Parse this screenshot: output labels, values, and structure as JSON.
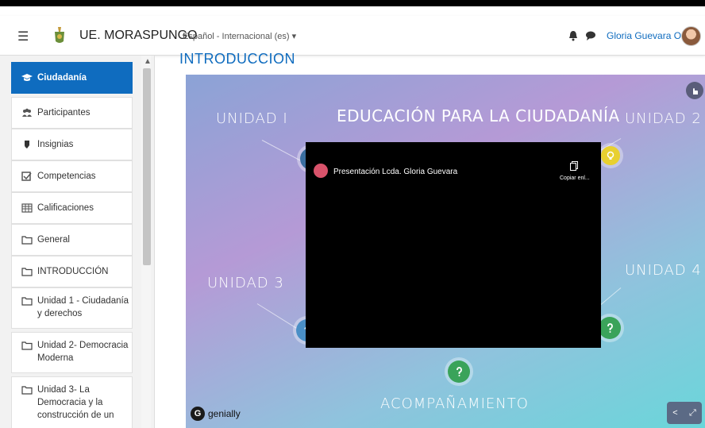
{
  "nav": {
    "menu_icon": "hamburger-icon",
    "site_name": "UE. MORASPUNGO",
    "language": "Español - Internacional (es) ▾",
    "user_name": "Gloria Guevara Ortiz"
  },
  "sidebar": {
    "items": [
      {
        "label": "Ciudadanía",
        "icon": "graduation-cap-icon"
      },
      {
        "label": "Participantes",
        "icon": "users-icon"
      },
      {
        "label": "Insignias",
        "icon": "shield-icon"
      },
      {
        "label": "Competencias",
        "icon": "checkbox-icon"
      },
      {
        "label": "Calificaciones",
        "icon": "table-icon"
      },
      {
        "label": "General",
        "icon": "folder-icon"
      },
      {
        "label": "INTRODUCCIÓN",
        "icon": "folder-icon"
      },
      {
        "label": "Unidad 1 - Ciudadanía y derechos",
        "icon": "folder-icon"
      },
      {
        "label": "Unidad 2- Democracia Moderna",
        "icon": "folder-icon"
      },
      {
        "label": "Unidad 3- La Democracia y la construcción de un",
        "icon": "folder-icon"
      }
    ]
  },
  "main": {
    "section_title": "INTRODUCCION",
    "genially": {
      "title": "EDUCACIÓN PARA LA CIUDADANÍA",
      "unidad1": "UNIDAD I",
      "unidad2": "UNIDAD 2",
      "unidad3": "UNIDAD 3",
      "unidad4": "UNIDAD 4",
      "acompanamiento": "ACOMPAÑAMIENTO",
      "video_title": "Presentación Lcda. Gloria Guevara",
      "copy_label": "Copiar enl...",
      "brand": "genially"
    }
  },
  "colors": {
    "primary": "#0f6cbf",
    "circle_blue": "#3f7fb0",
    "circle_yellow": "#e8d030",
    "circle_green": "#3aa35a",
    "circle_lightblue": "#4a8fc6"
  }
}
